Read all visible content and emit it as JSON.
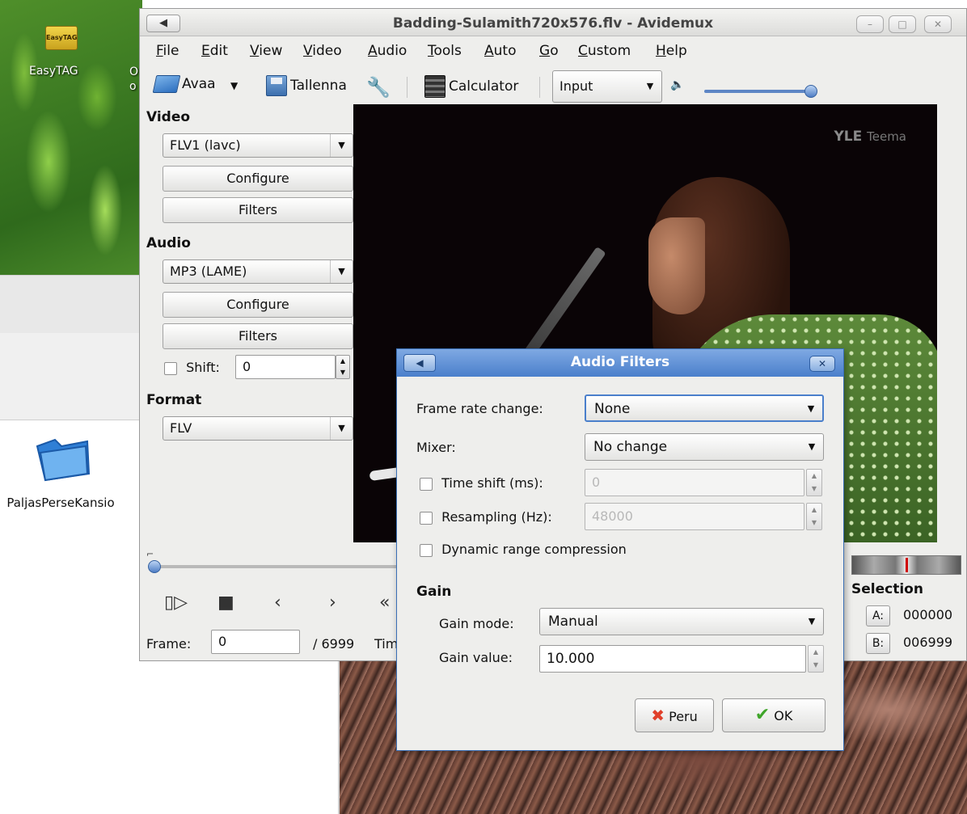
{
  "desktop": {
    "easytag_label": "EasyTAG",
    "easytag_badge": "EasyTAG",
    "cut_label_line1": "O",
    "cut_label_line2": "o",
    "folder_label": "PaljasPerseKansio"
  },
  "window": {
    "title": "Badding-Sulamith720x576.flv - Avidemux",
    "app_button": "◀",
    "minimize": "–",
    "maximize": "□",
    "close": "✕"
  },
  "menu": [
    "File",
    "Edit",
    "View",
    "Video",
    "Audio",
    "Tools",
    "Auto",
    "Go",
    "Custom",
    "Help"
  ],
  "toolbar": {
    "open_label": "Avaa",
    "save_label": "Tallenna",
    "calculator_label": "Calculator",
    "input_combo": "Input",
    "volume_icon": "speaker-icon",
    "volume_level": 1.0
  },
  "left_panel": {
    "video_heading": "Video",
    "video_codec": "FLV1 (lavc)",
    "video_configure": "Configure",
    "video_filters": "Filters",
    "audio_heading": "Audio",
    "audio_codec": "MP3 (LAME)",
    "audio_configure": "Configure",
    "audio_filters": "Filters",
    "shift_label": "Shift:",
    "shift_value": "0",
    "format_heading": "Format",
    "format_value": "FLV"
  },
  "video": {
    "watermark": "YLE",
    "watermark_sub": "Teema"
  },
  "bottom": {
    "frame_label": "Frame:",
    "frame_value": "0",
    "frame_total": "/ 6999",
    "time_label_cut": "Tim",
    "selection_heading": "Selection",
    "a_label": "A:",
    "a_value": "000000",
    "b_label": "B:",
    "b_value": "006999"
  },
  "dialog": {
    "title": "Audio Filters",
    "app_button": "◀",
    "close": "✕",
    "frame_rate_label": "Frame rate change:",
    "frame_rate_value": "None",
    "mixer_label": "Mixer:",
    "mixer_value": "No change",
    "time_shift_label": "Time shift (ms):",
    "time_shift_value": "0",
    "resampling_label": "Resampling (Hz):",
    "resampling_value": "48000",
    "drc_label": "Dynamic range compression",
    "gain_heading": "Gain",
    "gain_mode_label": "Gain mode:",
    "gain_mode_value": "Manual",
    "gain_value_label": "Gain value:",
    "gain_value": "10.000",
    "cancel_label": "Peru",
    "ok_label": "OK"
  },
  "colors": {
    "dialog_title_bar": "#4a7fcb",
    "slider_blue": "#5d86c5",
    "ok_check_green": "#3fa52a",
    "cancel_x_red": "#e0402a"
  }
}
